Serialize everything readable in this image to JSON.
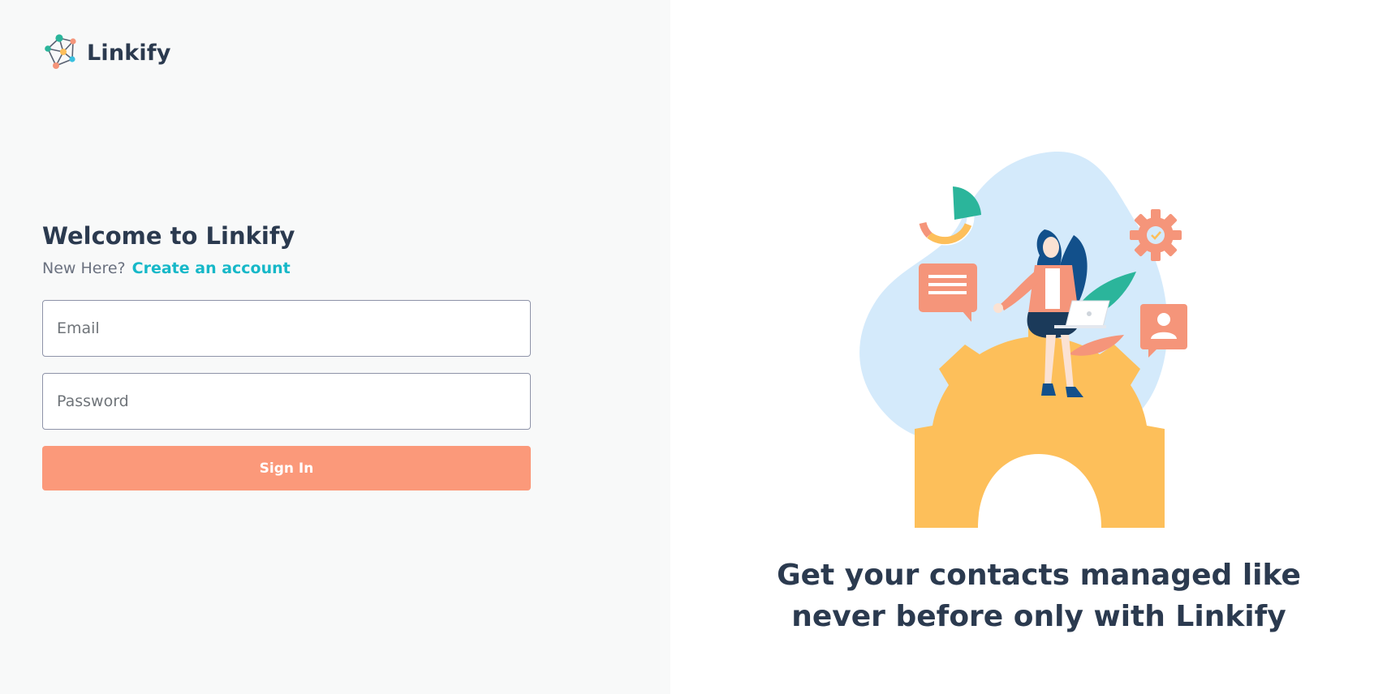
{
  "brand": {
    "name": "Linkify",
    "logo_icon": "network-nodes-icon"
  },
  "login": {
    "title": "Welcome to Linkify",
    "new_here_text": "New Here?",
    "create_account_link": "Create an account",
    "email_placeholder": "Email",
    "password_placeholder": "Password",
    "sign_in_label": "Sign In"
  },
  "hero": {
    "illustration": "woman-with-laptop-on-gear-illustration",
    "tagline": "Get your contacts managed like never before only with Linkify"
  },
  "colors": {
    "background_left": "#f8f9f9",
    "text_dark": "#2b3a4f",
    "link": "#16b8c8",
    "button": "#fb997a",
    "gear": "#fdbf5a",
    "blob": "#d4eafb",
    "accent_teal": "#2bb59b",
    "accent_coral": "#f5957a"
  }
}
